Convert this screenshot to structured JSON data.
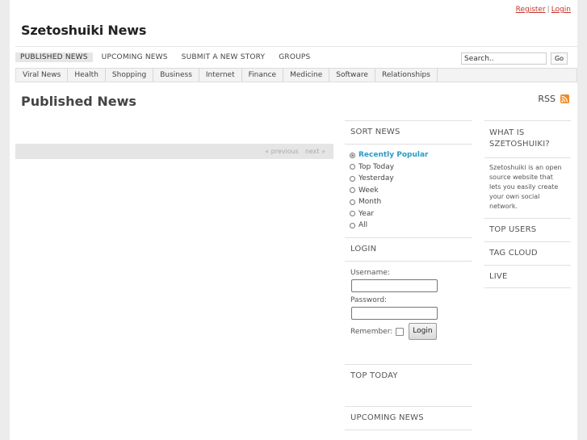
{
  "top_links": {
    "register": "Register",
    "separator": "|",
    "login": "Login"
  },
  "site": {
    "title": "Szetoshuiki News"
  },
  "main_nav": {
    "items": [
      {
        "label": "PUBLISHED NEWS"
      },
      {
        "label": "UPCOMING NEWS"
      },
      {
        "label": "SUBMIT A NEW STORY"
      },
      {
        "label": "GROUPS"
      }
    ]
  },
  "search": {
    "value": "Search..",
    "button": "Go"
  },
  "categories": [
    {
      "label": "Viral News"
    },
    {
      "label": "Health"
    },
    {
      "label": "Shopping"
    },
    {
      "label": "Business"
    },
    {
      "label": "Internet"
    },
    {
      "label": "Finance"
    },
    {
      "label": "Medicine"
    },
    {
      "label": "Software"
    },
    {
      "label": "Relationships"
    }
  ],
  "page": {
    "heading": "Published News",
    "rss": "RSS"
  },
  "pager": {
    "previous": "« previous",
    "next": "next »"
  },
  "sort_news": {
    "title": "SORT NEWS",
    "options": [
      {
        "label": "Recently Popular"
      },
      {
        "label": "Top Today"
      },
      {
        "label": "Yesterday"
      },
      {
        "label": "Week"
      },
      {
        "label": "Month"
      },
      {
        "label": "Year"
      },
      {
        "label": "All"
      }
    ]
  },
  "login_box": {
    "title": "LOGIN",
    "username_label": "Username:",
    "password_label": "Password:",
    "remember_label": "Remember:",
    "button": "Login"
  },
  "top_today": {
    "title": "TOP TODAY"
  },
  "upcoming_news": {
    "title": "UPCOMING NEWS"
  },
  "about": {
    "title": "WHAT IS SZETOSHUIKI?",
    "text": "Szetoshuiki is an open source website that lets you easily create your own social network."
  },
  "right_links": [
    {
      "label": "TOP USERS"
    },
    {
      "label": "TAG CLOUD"
    },
    {
      "label": "LIVE"
    }
  ]
}
